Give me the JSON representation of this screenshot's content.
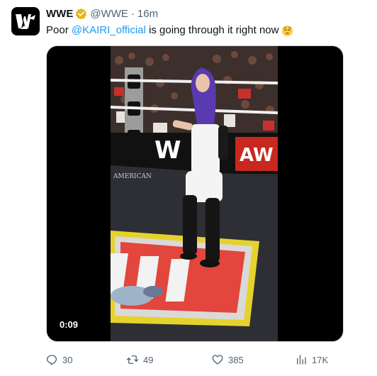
{
  "tweet": {
    "author_name": "WWE",
    "author_handle": "@WWE",
    "separator": "·",
    "time": "16m",
    "text_prefix": "Poor ",
    "mention": "@KAIRI_official",
    "text_suffix": " is going through it right now",
    "emoji": "pensive-face-emoji",
    "verified_badge_color": "#e2b719",
    "avatar_icon": "wwe-logo-icon"
  },
  "media": {
    "duration": "0:09",
    "overlay_brand": "AMERICAN"
  },
  "actions": {
    "replies": "30",
    "reposts": "49",
    "likes": "385",
    "views": "17K"
  },
  "colors": {
    "accent": "#1d9bf0",
    "muted": "#536471",
    "text": "#0f1419"
  }
}
